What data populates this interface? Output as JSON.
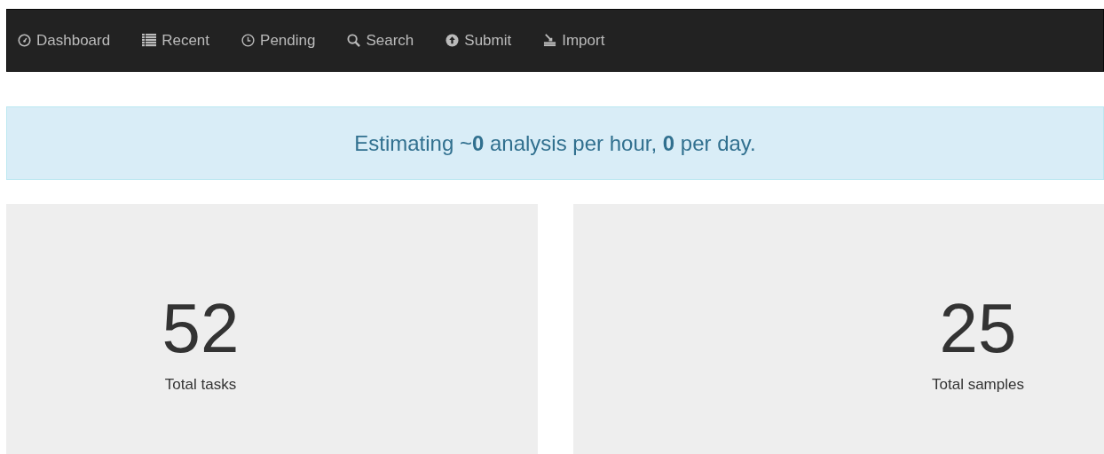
{
  "navbar": {
    "items": [
      {
        "label": "Dashboard"
      },
      {
        "label": "Recent"
      },
      {
        "label": "Pending"
      },
      {
        "label": "Search"
      },
      {
        "label": "Submit"
      },
      {
        "label": "Import"
      }
    ]
  },
  "alert": {
    "text": "Estimating ~**0** analysis per hour, **0** per day."
  },
  "stats": [
    {
      "value": "52",
      "label": "Total tasks"
    },
    {
      "value": "25",
      "label": "Total samples"
    }
  ]
}
